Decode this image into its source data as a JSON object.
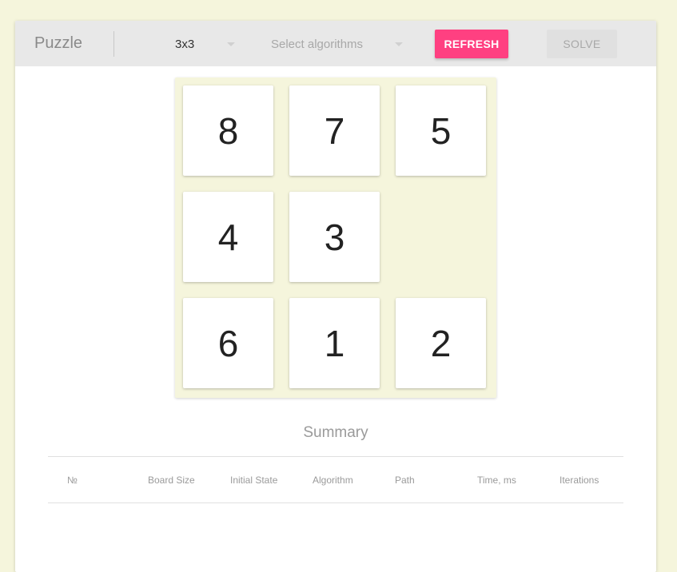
{
  "toolbar": {
    "title": "Puzzle",
    "size_select": "3x3",
    "algorithm_placeholder": "Select algorithms",
    "refresh_label": "REFRESH",
    "solve_label": "SOLVE"
  },
  "board": {
    "size": 3,
    "tiles": [
      "8",
      "7",
      "5",
      "4",
      "3",
      "",
      "6",
      "1",
      "2"
    ]
  },
  "summary": {
    "title": "Summary",
    "columns": [
      "№",
      "Board Size",
      "Initial State",
      "Algorithm",
      "Path",
      "Time, ms",
      "Iterations"
    ]
  },
  "colors": {
    "page_background": "#f5f5dc",
    "accent": "#ff4081",
    "toolbar": "#e8e8e8"
  }
}
